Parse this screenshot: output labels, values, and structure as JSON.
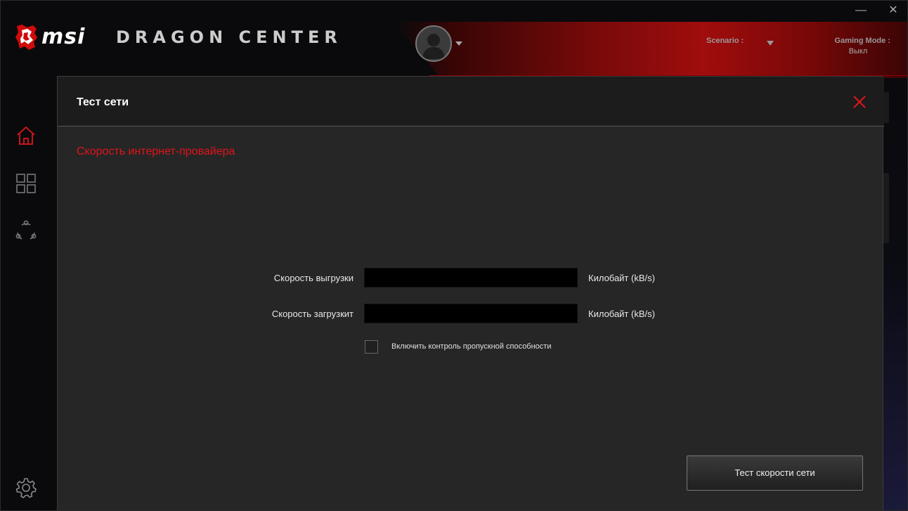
{
  "window": {
    "minimize_label": "—",
    "close_label": "✕"
  },
  "header": {
    "brand": "msi",
    "product": "DRAGON CENTER",
    "scenario_label": "Scenario :",
    "gaming_mode_label": "Gaming Mode :",
    "gaming_mode_value": "Выкл"
  },
  "sidebar": {
    "items": [
      {
        "icon": "home-icon",
        "active": true
      },
      {
        "icon": "apps-grid-icon",
        "active": false
      },
      {
        "icon": "share-network-icon",
        "active": false
      },
      {
        "icon": "settings-gear-icon",
        "active": false
      }
    ]
  },
  "dialog": {
    "title": "Тест сети",
    "section_title": "Скорость интернет-провайера",
    "upload_label": "Скорость выгрузки",
    "upload_value": "",
    "upload_unit": "Килобайт (kB/s)",
    "download_label": "Скорость загрузкит",
    "download_value": "",
    "download_unit": "Килобайт (kB/s)",
    "bandwidth_checkbox_label": "Включить контроль пропускной способности",
    "bandwidth_checked": false,
    "test_button_label": "Тест скорости сети"
  },
  "colors": {
    "accent_red": "#e1141a",
    "dialog_bg": "#262626",
    "header_bg": "#1c1c1c"
  }
}
